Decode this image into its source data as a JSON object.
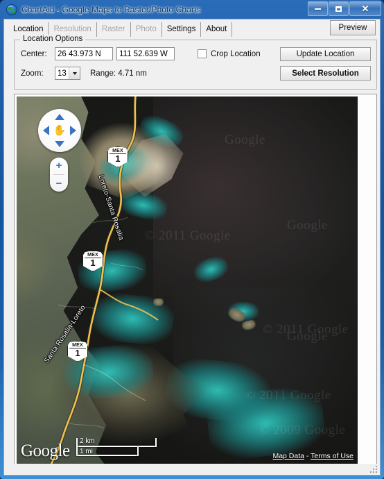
{
  "window": {
    "title": "ChartAid - Google Maps to Raster/Photo Charts",
    "icon": "globe-icon",
    "minimize_label": "–",
    "maximize_label": "□",
    "close_label": "✕"
  },
  "tabs": [
    {
      "label": "Location",
      "state": "active"
    },
    {
      "label": "Resolution",
      "state": "disabled"
    },
    {
      "label": "Raster",
      "state": "disabled"
    },
    {
      "label": "Photo",
      "state": "disabled"
    },
    {
      "label": "Settings",
      "state": "enabled"
    },
    {
      "label": "About",
      "state": "enabled"
    }
  ],
  "toolbar": {
    "preview_label": "Preview"
  },
  "location_options": {
    "group_title": "Location Options",
    "center_label": "Center:",
    "center_lat": "26 43.973 N",
    "center_lon": "111 52.639 W",
    "zoom_label": "Zoom:",
    "zoom_value": "13",
    "range_text": "Range: 4.71 nm",
    "crop_label": "Crop Location",
    "crop_checked": false,
    "update_button": "Update Location",
    "select_resolution_button": "Select Resolution"
  },
  "map": {
    "pan_control": "pan-control",
    "hand_glyph": "✋",
    "zoom_in_label": "+",
    "zoom_out_label": "−",
    "shields": [
      {
        "route": "MEX",
        "number": "1"
      },
      {
        "route": "MEX",
        "number": "1"
      },
      {
        "route": "MEX",
        "number": "1"
      }
    ],
    "road_labels": [
      "Loreto-Santa Rosalia",
      "Santa Rosalia-Loreto"
    ],
    "watermarks": [
      "© 2011 Google",
      "© 2011 Google",
      "© 2011 Google",
      "Google",
      "Google",
      "Google",
      "© 2009 Google"
    ],
    "logo_text": "Google",
    "scale_km": "2 km",
    "scale_mi": "1 mi",
    "attribution": {
      "map_data": "Map Data",
      "separator": " - ",
      "terms": "Terms of Use"
    }
  },
  "colors": {
    "accent_blue": "#3b73c4",
    "titlebar": "#1f5ea8",
    "highway": "#f0c050",
    "shallow_water": "#2ec4ba"
  }
}
